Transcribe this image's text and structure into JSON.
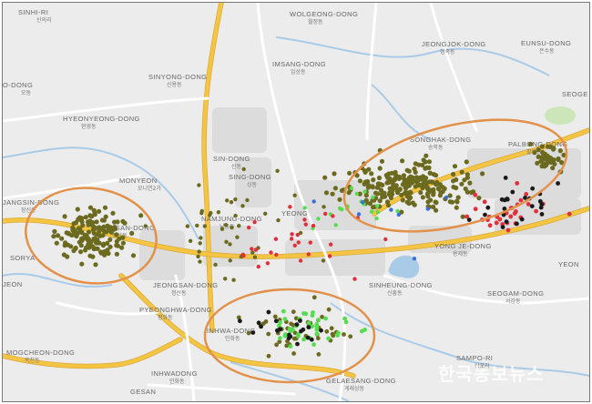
{
  "map": {
    "palette": {
      "background": "#ececec",
      "water": "#a9cbe7",
      "highway": "#f4c543",
      "major_road": "#ffffff",
      "urban_block": "#dcdcdc",
      "park": "#cde6b9",
      "ellipse": "#e2914a",
      "dot_main": "#6b6a1f",
      "dot_green": "#55dd4f",
      "dot_red": "#e0303c",
      "dot_black": "#1a1a1a",
      "dot_blue": "#3b6fd8"
    },
    "labels": [
      {
        "id": "label-sinhi-ri",
        "en": "SINHI-RI",
        "ko": "신의리"
      },
      {
        "id": "label-wolgeong-dong",
        "en": "WOLGEONG-DONG",
        "ko": "월정동"
      },
      {
        "id": "label-jeongjok-dong",
        "en": "JEONGJOK-DONG",
        "ko": "정족동"
      },
      {
        "id": "label-eunsu-dong",
        "en": "EUNSU-DONG",
        "ko": "은수동"
      },
      {
        "id": "label-imsang-dong",
        "en": "IMSANG-DONG",
        "ko": "임상동"
      },
      {
        "id": "label-seoge",
        "en": "SEOGE",
        "ko": ""
      },
      {
        "id": "label-sinyong-dong",
        "en": "SINYONG-DONG",
        "ko": "신용동"
      },
      {
        "id": "label-o-dong",
        "en": "O-DONG",
        "ko": "오동"
      },
      {
        "id": "label-hyeonyeong-dong",
        "en": "HYEONYEONG-DONG",
        "ko": "현영동"
      },
      {
        "id": "label-palbong-dong",
        "en": "PALBONG-DONG",
        "ko": "팔봉동"
      },
      {
        "id": "label-songhak-dong",
        "en": "SONGHAK-DONG",
        "ko": "송학동"
      },
      {
        "id": "label-sin-dong",
        "en": "SIN-DONG",
        "ko": "신동"
      },
      {
        "id": "label-sing-dong",
        "en": "SING-DONG",
        "ko": "싱동"
      },
      {
        "id": "label-monyeon",
        "en": "MONYEON",
        "ko": "모니연2가"
      },
      {
        "id": "label-namjung-dong",
        "en": "NAMJUNG-DONG",
        "ko": "남중동"
      },
      {
        "id": "label-yeong",
        "en": "YEONG",
        "ko": ""
      },
      {
        "id": "label-jangsin-dong",
        "en": "JANGSIN-DONG",
        "ko": "장신동"
      },
      {
        "id": "label-songsan-dong",
        "en": "SONGSAN-DONG",
        "ko": "송산동"
      },
      {
        "id": "label-sorya",
        "en": "SORYA",
        "ko": ""
      },
      {
        "id": "label-yongje-dong",
        "en": "YONG JE-DONG",
        "ko": "용제동"
      },
      {
        "id": "label-jeon",
        "en": "JEON",
        "ko": ""
      },
      {
        "id": "label-jeongsan-dong",
        "en": "JEONGSAN-DONG",
        "ko": "정산동"
      },
      {
        "id": "label-sinheung-dong",
        "en": "SINHEUNG-DONG",
        "ko": "신흥동"
      },
      {
        "id": "label-yeon",
        "en": "YEON",
        "ko": ""
      },
      {
        "id": "label-seogam-dong",
        "en": "SEOGAM-DONG",
        "ko": "서감동"
      },
      {
        "id": "label-pyeonghwa-dong",
        "en": "PYEONGHWA-DONG",
        "ko": "평화동"
      },
      {
        "id": "label-inhwa-dong",
        "en": "INHWA-DONG",
        "ko": "인화동"
      },
      {
        "id": "label-mogcheon-dong",
        "en": "MOGCHEON-DONG",
        "ko": "목천동"
      },
      {
        "id": "label-sampo-ri",
        "en": "SAMPO-RI",
        "ko": "삼포리"
      },
      {
        "id": "label-inhwadong",
        "en": "INHWADONG",
        "ko": "인화동"
      },
      {
        "id": "label-gesan",
        "en": "GESAN",
        "ko": ""
      },
      {
        "id": "label-gelaesang-dong",
        "en": "GELAESANG-DONG",
        "ko": "게래상동"
      }
    ],
    "watermark": "한국농보뉴스"
  }
}
